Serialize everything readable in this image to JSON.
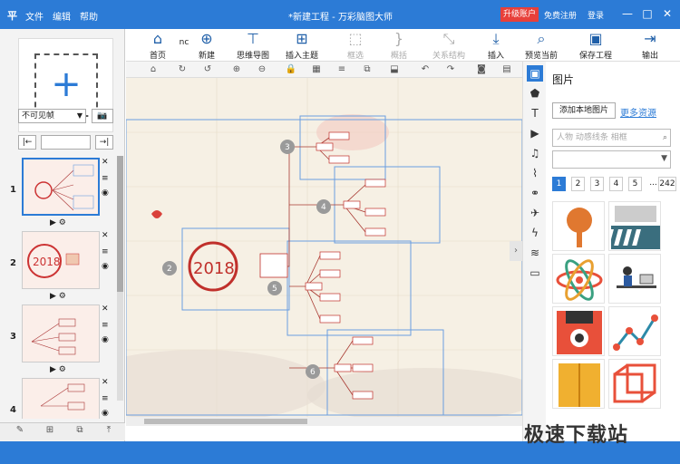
{
  "app": {
    "icon": "平",
    "title": "*新建工程 - 万彩脑图大师",
    "menu": [
      "文件",
      "编辑",
      "帮助"
    ],
    "upgrade": "升级账户",
    "register": "免费注册",
    "login": "登录"
  },
  "toolbar": {
    "items": [
      {
        "label": "首页",
        "icon": "home-icon"
      },
      {
        "label": "新建",
        "icon": "new-icon"
      },
      {
        "label": "思维导图",
        "icon": "mindmap-icon"
      },
      {
        "label": "插入主题",
        "icon": "insert-topic-icon"
      },
      {
        "label": "框选",
        "icon": "select-frame-icon"
      },
      {
        "label": "概括",
        "icon": "summary-icon"
      },
      {
        "label": "关系结构",
        "icon": "relation-icon"
      },
      {
        "label": "插入",
        "icon": "insert-icon"
      },
      {
        "label": "预览当前",
        "icon": "preview-icon"
      },
      {
        "label": "保存工程",
        "icon": "save-icon"
      },
      {
        "label": "输出",
        "icon": "export-icon"
      }
    ],
    "nc_label": "nc"
  },
  "left": {
    "frame_select": "不可见帧",
    "go": "go",
    "slides": [
      {
        "n": "1",
        "selected": true
      },
      {
        "n": "2",
        "selected": false
      },
      {
        "n": "3",
        "selected": false
      },
      {
        "n": "4",
        "selected": false
      }
    ]
  },
  "canvas": {
    "center_text": "2018",
    "nodes": [
      "2",
      "3",
      "4",
      "5",
      "6"
    ]
  },
  "right": {
    "title": "图片",
    "add_local": "添加本地图片",
    "more": "更多资源",
    "search_placeholder": "人物 动感线条 相框",
    "pages": [
      "1",
      "2",
      "3",
      "4",
      "5",
      "...",
      "242"
    ]
  },
  "watermark": "极速下载站"
}
